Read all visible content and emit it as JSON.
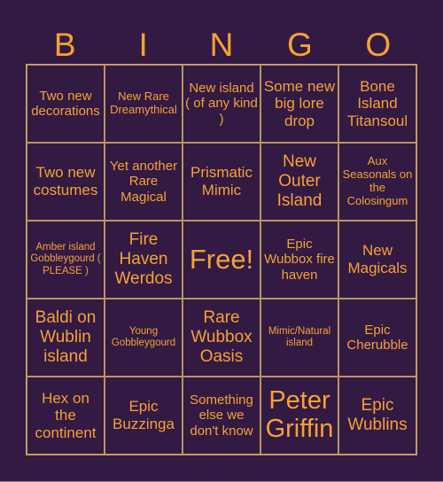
{
  "header": [
    "B",
    "I",
    "N",
    "G",
    "O"
  ],
  "colors": {
    "background": "#321a43",
    "text": "#f7a135",
    "border": "#b8955e"
  },
  "cells": [
    {
      "text": "Two new decorations",
      "size": "s-m"
    },
    {
      "text": "New Rare Dreamythical",
      "size": "s-s"
    },
    {
      "text": "New island ( of any kind )",
      "size": "s-m"
    },
    {
      "text": "Some new big lore drop",
      "size": "s-l"
    },
    {
      "text": "Bone Island Titansoul",
      "size": "s-l"
    },
    {
      "text": "Two new costumes",
      "size": "s-l"
    },
    {
      "text": "Yet another Rare Magical",
      "size": "s-m"
    },
    {
      "text": "Prismatic Mimic",
      "size": "s-l"
    },
    {
      "text": "New Outer Island",
      "size": "s-xl"
    },
    {
      "text": "Aux Seasonals on the Colosingum",
      "size": "s-s"
    },
    {
      "text": "Amber island Gobbleygourd ( PLEASE )",
      "size": "s-xs"
    },
    {
      "text": "Fire Haven Werdos",
      "size": "s-xl"
    },
    {
      "text": "Free!",
      "size": "s-free"
    },
    {
      "text": "Epic Wubbox fire haven",
      "size": "s-m"
    },
    {
      "text": "New Magicals",
      "size": "s-l"
    },
    {
      "text": "Baldi on Wublin island",
      "size": "s-xl"
    },
    {
      "text": "Young Gobbleygourd",
      "size": "s-xs"
    },
    {
      "text": "Rare Wubbox Oasis",
      "size": "s-xl"
    },
    {
      "text": "Mimic/Natural island",
      "size": "s-xs"
    },
    {
      "text": "Epic Cherubble",
      "size": "s-m"
    },
    {
      "text": "Hex on the continent",
      "size": "s-l"
    },
    {
      "text": "Epic Buzzinga",
      "size": "s-l"
    },
    {
      "text": "Something else we don't know",
      "size": "s-m"
    },
    {
      "text": "Peter Griffin",
      "size": "s-xxl"
    },
    {
      "text": "Epic Wublins",
      "size": "s-xl"
    }
  ]
}
